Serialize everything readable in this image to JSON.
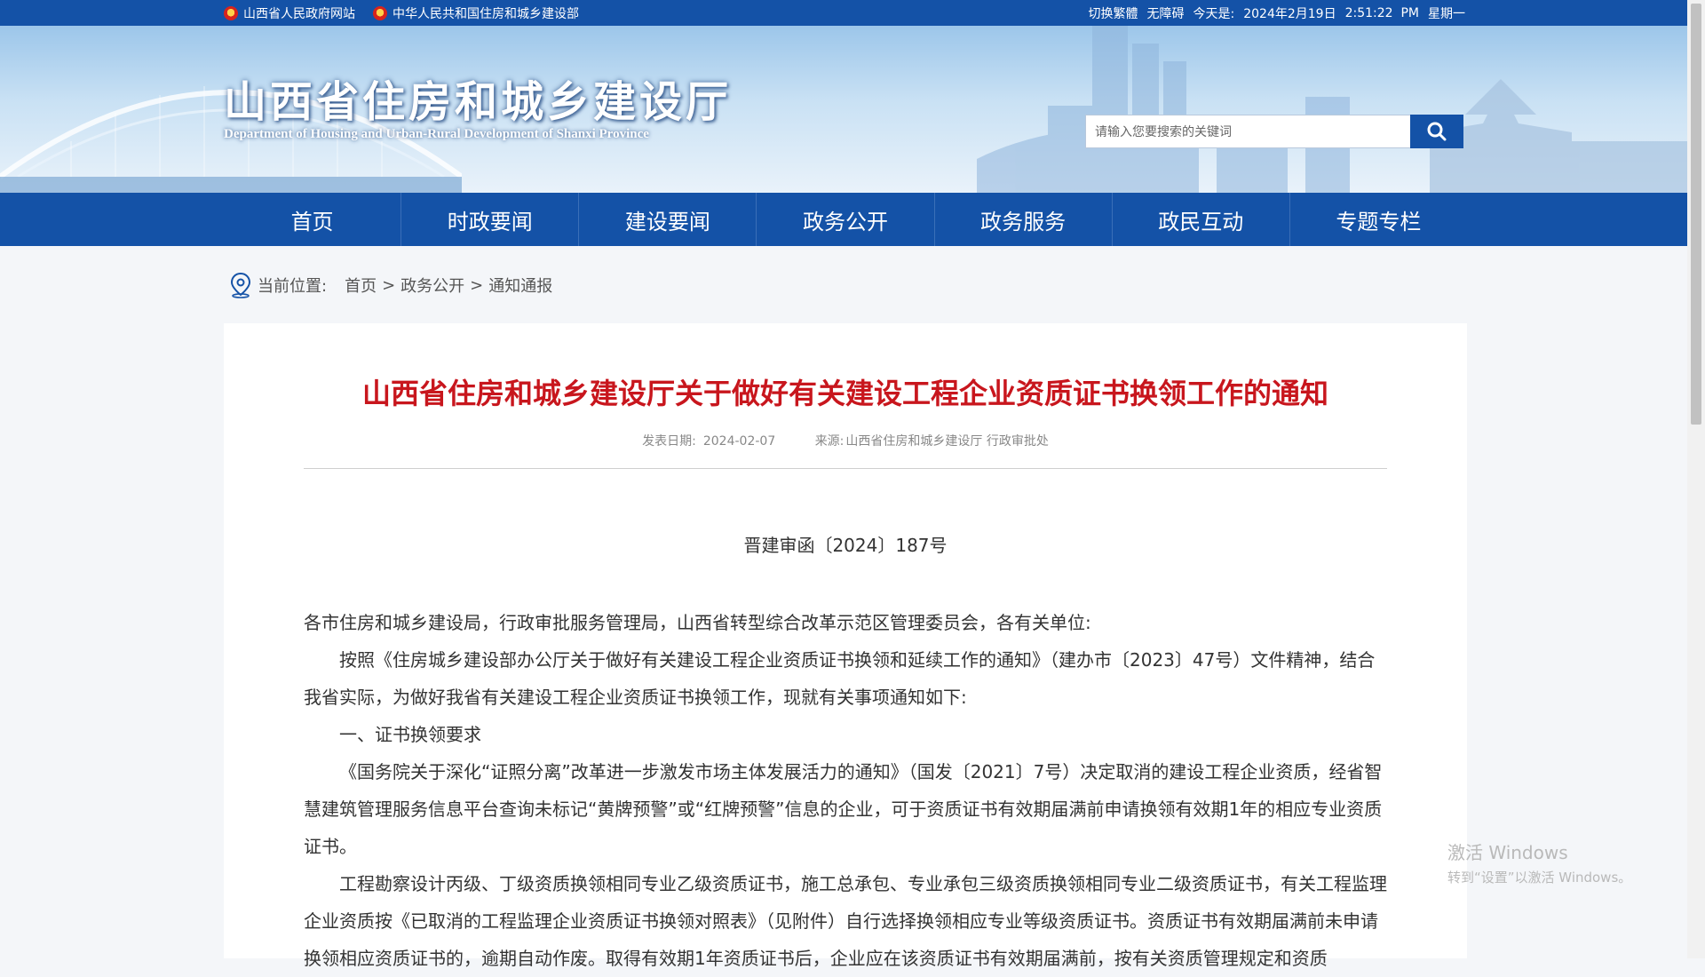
{
  "topbar": {
    "link_gov": "山西省人民政府网站",
    "link_ministry": "中华人民共和国住房和城乡建设部",
    "switch_lang": "切换繁體",
    "accessibility": "无障碍",
    "today_label": "今天是:",
    "date": "2024年2月19日",
    "time": "2:51:22  PM",
    "weekday": "星期一"
  },
  "header": {
    "title": "山西省住房和城乡建设厅",
    "subtitle": "Department of Housing and Urban-Rural Development of Shanxi Province",
    "search_placeholder": "请输入您要搜索的关键词"
  },
  "nav": {
    "items": [
      "首页",
      "时政要闻",
      "建设要闻",
      "政务公开",
      "政务服务",
      "政民互动",
      "专题专栏"
    ]
  },
  "breadcrumb": {
    "label": "当前位置:",
    "items": [
      "首页",
      "政务公开",
      "通知通报"
    ],
    "separator": ">"
  },
  "article": {
    "title": "山西省住房和城乡建设厅关于做好有关建设工程企业资质证书换领工作的通知",
    "date_label": "发表日期:",
    "date": "2024-02-07",
    "source_label": "来源:",
    "source": "山西省住房和城乡建设厅 行政审批处",
    "doc_number": "晋建审函〔2024〕187号",
    "paragraphs": [
      "各市住房和城乡建设局，行政审批服务管理局，山西省转型综合改革示范区管理委员会，各有关单位:",
      "按照《住房城乡建设部办公厅关于做好有关建设工程企业资质证书换领和延续工作的通知》（建办市〔2023〕47号）文件精神，结合我省实际，为做好我省有关建设工程企业资质证书换领工作，现就有关事项通知如下:",
      "一、证书换领要求",
      "《国务院关于深化“证照分离”改革进一步激发市场主体发展活力的通知》（国发〔2021〕7号）决定取消的建设工程企业资质，经省智慧建筑管理服务信息平台查询未标记“黄牌预警”或“红牌预警”信息的企业，可于资质证书有效期届满前申请换领有效期1年的相应专业资质证书。",
      "工程勘察设计丙级、丁级资质换领相同专业乙级资质证书，施工总承包、专业承包三级资质换领相同专业二级资质证书，有关工程监理企业资质按《已取消的工程监理企业资质证书换领对照表》（见附件）自行选择换领相应专业等级资质证书。资质证书有效期届满前未申请换领相应资质证书的，逾期自动作废。取得有效期1年资质证书后，企业应在该资质证书有效期届满前，按有关资质管理规定和资质"
    ]
  },
  "watermark": {
    "line1": "激活 Windows",
    "line2": "转到“设置”以激活 Windows。"
  }
}
